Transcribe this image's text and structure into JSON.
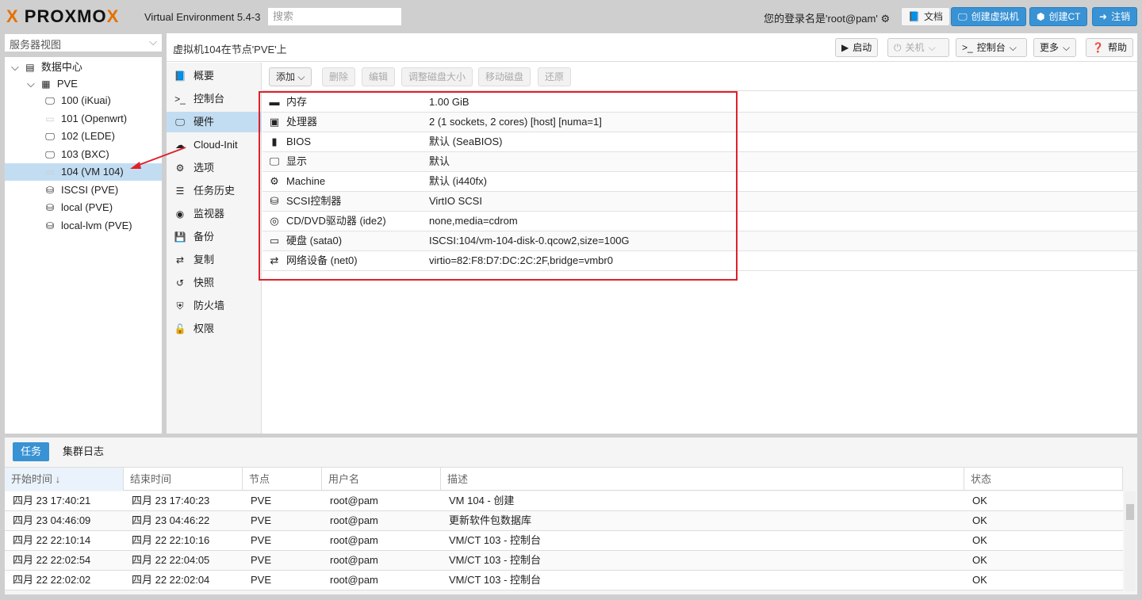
{
  "header": {
    "logo": "PROXMOX",
    "version": "Virtual Environment 5.4-3",
    "search_placeholder": "搜索",
    "login": "您的登录名是'root@pam'",
    "docs": "文档",
    "create_vm": "创建虚拟机",
    "create_ct": "创建CT",
    "logout": "注销"
  },
  "sidebar": {
    "view": "服务器视图",
    "tree": [
      {
        "label": "数据中心",
        "icon": "datacenter-icon",
        "level": 0
      },
      {
        "label": "PVE",
        "icon": "node-online-icon",
        "level": 1
      },
      {
        "label": "100 (iKuai)",
        "icon": "vm-running-icon",
        "level": 2
      },
      {
        "label": "101 (Openwrt)",
        "icon": "vm-stopped-icon",
        "level": 2
      },
      {
        "label": "102 (LEDE)",
        "icon": "vm-running-icon",
        "level": 2
      },
      {
        "label": "103 (BXC)",
        "icon": "vm-running-icon",
        "level": 2
      },
      {
        "label": "104 (VM 104)",
        "icon": "vm-stopped-icon",
        "level": 2,
        "selected": true
      },
      {
        "label": "ISCSI (PVE)",
        "icon": "storage-icon",
        "level": 2
      },
      {
        "label": "local (PVE)",
        "icon": "storage-icon",
        "level": 2
      },
      {
        "label": "local-lvm (PVE)",
        "icon": "storage-icon",
        "level": 2
      }
    ]
  },
  "main": {
    "title": "虚拟机104在节点'PVE'上",
    "buttons": {
      "start": "启动",
      "shutdown": "关机",
      "console": "控制台",
      "more": "更多",
      "help": "帮助"
    },
    "nav": [
      {
        "label": "概要",
        "icon": "book-icon"
      },
      {
        "label": "控制台",
        "icon": "terminal-icon"
      },
      {
        "label": "硬件",
        "icon": "monitor-icon",
        "active": true
      },
      {
        "label": "Cloud-Init",
        "icon": "cloud-icon"
      },
      {
        "label": "选项",
        "icon": "gear-icon"
      },
      {
        "label": "任务历史",
        "icon": "list-icon"
      },
      {
        "label": "监视器",
        "icon": "eye-icon"
      },
      {
        "label": "备份",
        "icon": "floppy-icon"
      },
      {
        "label": "复制",
        "icon": "retweet-icon"
      },
      {
        "label": "快照",
        "icon": "history-icon"
      },
      {
        "label": "防火墙",
        "icon": "shield-icon"
      },
      {
        "label": "权限",
        "icon": "unlock-icon"
      }
    ],
    "toolbar": {
      "add": "添加",
      "remove": "删除",
      "edit": "编辑",
      "resize": "调整磁盘大小",
      "move": "移动磁盘",
      "revert": "还原"
    },
    "hardware": [
      {
        "icon": "memory-icon",
        "key": "内存",
        "value": "1.00 GiB"
      },
      {
        "icon": "cpu-icon",
        "key": "处理器",
        "value": "2 (1 sockets, 2 cores) [host] [numa=1]"
      },
      {
        "icon": "bios-icon",
        "key": "BIOS",
        "value": "默认 (SeaBIOS)"
      },
      {
        "icon": "display-icon",
        "key": "显示",
        "value": "默认"
      },
      {
        "icon": "cogs-icon",
        "key": "Machine",
        "value": "默认 (i440fx)"
      },
      {
        "icon": "database-icon",
        "key": "SCSI控制器",
        "value": "VirtIO SCSI"
      },
      {
        "icon": "cdrom-icon",
        "key": "CD/DVD驱动器 (ide2)",
        "value": "none,media=cdrom"
      },
      {
        "icon": "hdd-icon",
        "key": "硬盘 (sata0)",
        "value": "ISCSI:104/vm-104-disk-0.qcow2,size=100G"
      },
      {
        "icon": "network-icon",
        "key": "网络设备 (net0)",
        "value": "virtio=82:F8:D7:DC:2C:2F,bridge=vmbr0"
      }
    ]
  },
  "bottom": {
    "tabs": [
      "任务",
      "集群日志"
    ],
    "columns": [
      "开始时间 ↓",
      "结束时间",
      "节点",
      "用户名",
      "描述",
      "状态"
    ],
    "rows": [
      [
        "四月 23 17:40:21",
        "四月 23 17:40:23",
        "PVE",
        "root@pam",
        "VM 104 - 创建",
        "OK"
      ],
      [
        "四月 23 04:46:09",
        "四月 23 04:46:22",
        "PVE",
        "root@pam",
        "更新软件包数据库",
        "OK"
      ],
      [
        "四月 22 22:10:14",
        "四月 22 22:10:16",
        "PVE",
        "root@pam",
        "VM/CT 103 - 控制台",
        "OK"
      ],
      [
        "四月 22 22:02:54",
        "四月 22 22:04:05",
        "PVE",
        "root@pam",
        "VM/CT 103 - 控制台",
        "OK"
      ],
      [
        "四月 22 22:02:02",
        "四月 22 22:02:04",
        "PVE",
        "root@pam",
        "VM/CT 103 - 控制台",
        "OK"
      ]
    ]
  },
  "colors": {
    "accent": "#3892d4",
    "selected": "#c2ddf2",
    "highlight": "#e0202a"
  }
}
